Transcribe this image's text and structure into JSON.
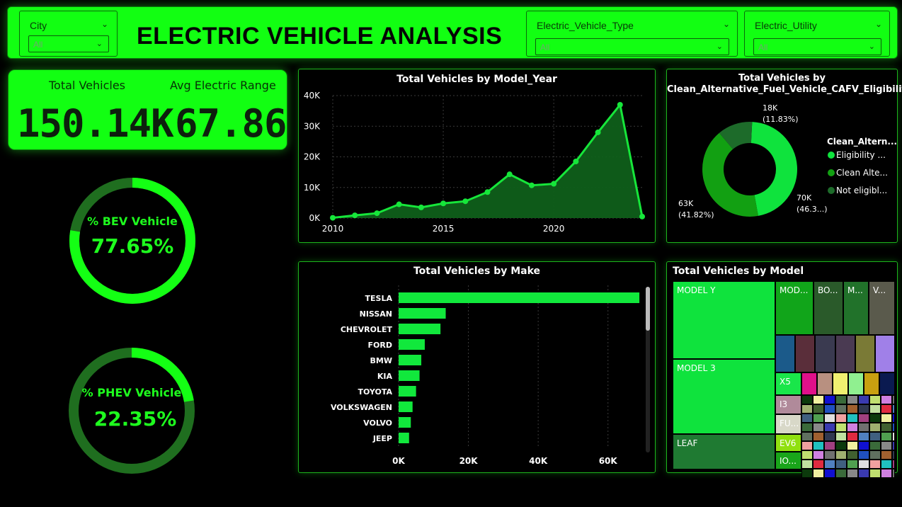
{
  "header": {
    "title": "ELECTRIC VEHICLE ANALYSIS",
    "slicers": {
      "city": {
        "label": "City",
        "value": "All"
      },
      "ev_type": {
        "label": "Electric_Vehicle_Type",
        "value": "All"
      },
      "utility": {
        "label": "Electric_Utility",
        "value": "All"
      }
    }
  },
  "kpi": {
    "total_vehicles_label": "Total Vehicles",
    "total_vehicles_value": "150.14K",
    "avg_range_label": "Avg Electric Range",
    "avg_range_value": "67.86"
  },
  "bev": {
    "label": "% BEV Vehicle",
    "value": "77.65%",
    "fraction": 0.7765
  },
  "phev": {
    "label": "% PHEV Vehicle",
    "value": "22.35%",
    "fraction": 0.2235
  },
  "colors": {
    "accent": "#12ff12",
    "dark_green": "#1f6e1f",
    "mid_green": "#14b814",
    "panel_border": "#1db41d"
  },
  "chart_data": [
    {
      "type": "area",
      "title": "Total Vehicles by Model_Year",
      "x": [
        2010,
        2011,
        2012,
        2013,
        2014,
        2015,
        2016,
        2017,
        2018,
        2019,
        2020,
        2021,
        2022,
        2023,
        2024
      ],
      "values": [
        100,
        900,
        1600,
        4500,
        3500,
        4800,
        5500,
        8500,
        14300,
        10700,
        11200,
        18500,
        28000,
        37000,
        500
      ],
      "xticks": [
        "2010",
        "2015",
        "2020"
      ],
      "yticks": [
        "0K",
        "10K",
        "20K",
        "30K",
        "40K"
      ],
      "ylim": [
        0,
        40000
      ],
      "grid": true
    },
    {
      "type": "pie",
      "title": "Total Vehicles by Clean_Alternative_Fuel_Vehicle_CAFV_Eligibility",
      "legend_title": "Clean_Altern...",
      "legend_position": "right",
      "slices": [
        {
          "name": "Eligibility ...",
          "value": 70000,
          "label": "70K",
          "pct": "(46.3...)",
          "color": "#0fe33d"
        },
        {
          "name": "Clean Alte...",
          "value": 63000,
          "label": "63K",
          "pct": "(41.82%)",
          "color": "#12a012"
        },
        {
          "name": "Not eligibl...",
          "value": 18000,
          "label": "18K",
          "pct": "(11.83%)",
          "color": "#1d6b2a"
        }
      ]
    },
    {
      "type": "bar",
      "orientation": "horizontal",
      "title": "Total Vehicles by Make",
      "categories": [
        "TESLA",
        "NISSAN",
        "CHEVROLET",
        "FORD",
        "BMW",
        "KIA",
        "TOYOTA",
        "VOLKSWAGEN",
        "VOLVO",
        "JEEP"
      ],
      "values": [
        69000,
        13500,
        12000,
        7500,
        6500,
        6000,
        5000,
        4000,
        3500,
        3000
      ],
      "xticks": [
        "0K",
        "20K",
        "40K",
        "60K"
      ],
      "xlim": [
        0,
        70000
      ],
      "grid": true
    },
    {
      "type": "treemap",
      "title": "Total Vehicles by Model",
      "labels": [
        "MODEL Y",
        "MODEL 3",
        "LEAF",
        "MOD...",
        "BO...",
        "M...",
        "V...",
        "X5",
        "I3",
        "FU...",
        "EV6",
        "IO..."
      ]
    }
  ]
}
